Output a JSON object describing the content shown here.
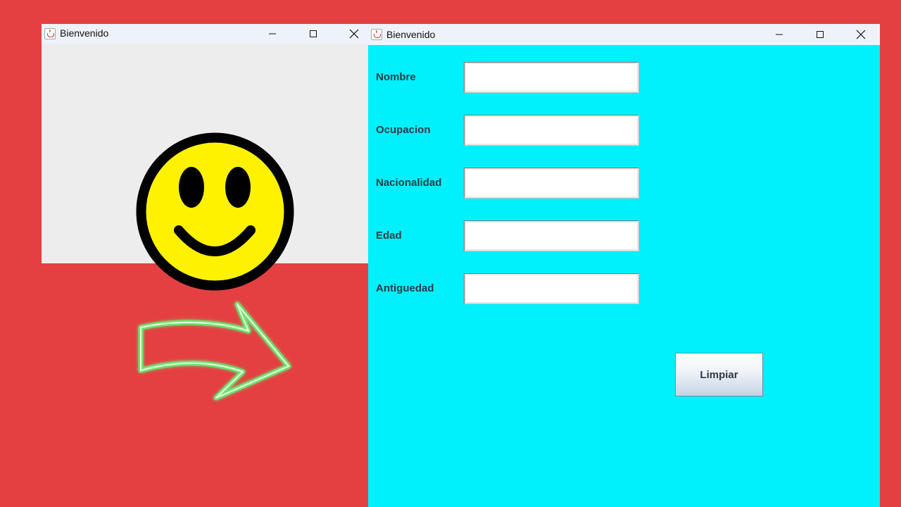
{
  "windows": {
    "left": {
      "title": "Bienvenido"
    },
    "right": {
      "title": "Bienvenido",
      "fields": [
        {
          "label": "Nombre",
          "value": ""
        },
        {
          "label": "Ocupacion",
          "value": ""
        },
        {
          "label": "Nacionalidad",
          "value": ""
        },
        {
          "label": "Edad",
          "value": ""
        },
        {
          "label": "Antiguedad",
          "value": ""
        }
      ],
      "clear_button_label": "Limpiar"
    }
  },
  "decorations": {
    "smiley": "smiley-face-icon",
    "arrow": "curved-right-arrow-icon"
  },
  "colors": {
    "background": "#e44042",
    "left_window_bg": "#ededed",
    "right_window_bg": "#00f0fc",
    "titlebar_bg": "#eef3fa",
    "smiley_fill": "#fff200",
    "arrow_glow": "#6ee36e"
  }
}
